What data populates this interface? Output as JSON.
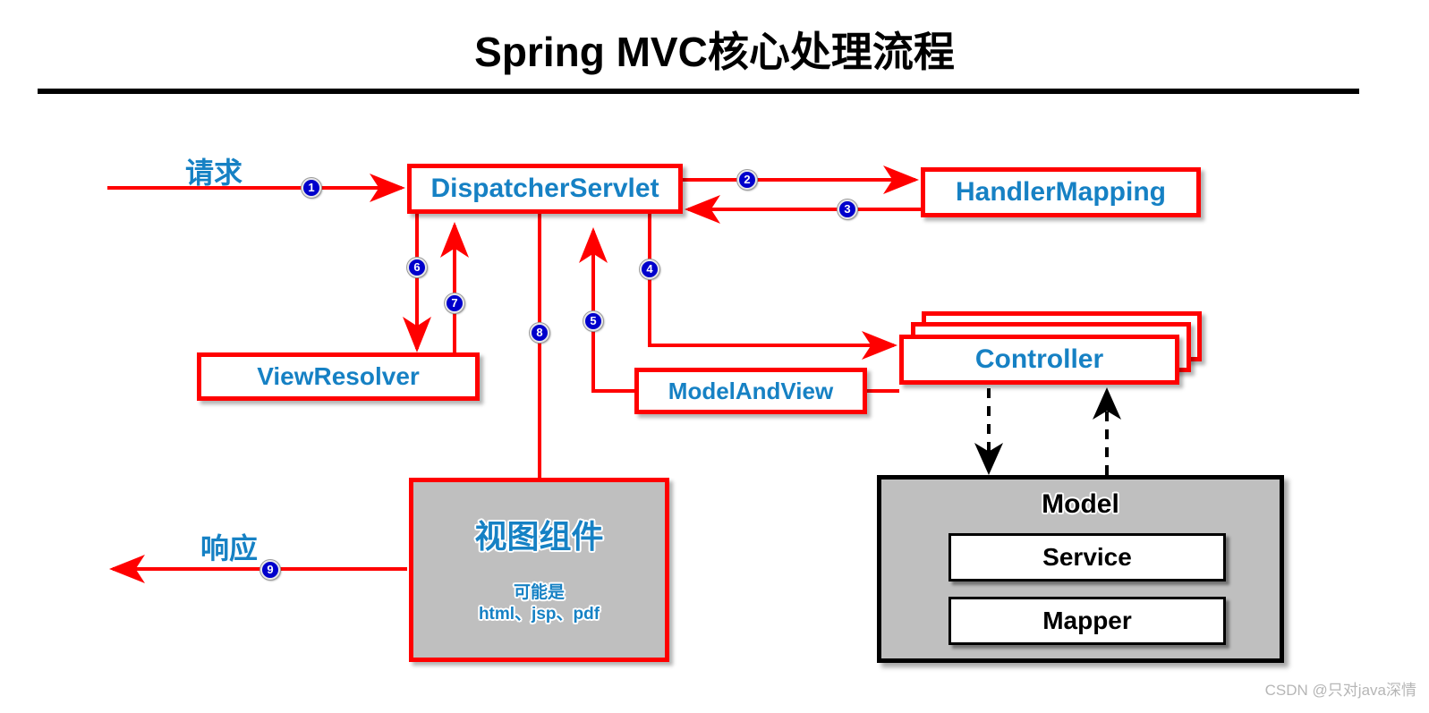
{
  "page": {
    "title": "Spring MVC核心处理流程",
    "watermark": "CSDN @只对java深情",
    "colors": {
      "arrow_red": "#FF0000",
      "node_text_blue": "#1681C4",
      "badge_blue": "#0000CC",
      "panel_gray": "#BFBFBF",
      "rule_black": "#000000"
    }
  },
  "nodes": {
    "dispatcher": "DispatcherServlet",
    "handler_mapping": "HandlerMapping",
    "view_resolver": "ViewResolver",
    "model_and_view": "ModelAndView",
    "controller": "Controller",
    "view_component": {
      "title": "视图组件",
      "subtitle_line1": "可能是",
      "subtitle_line2": "html、jsp、pdf"
    },
    "model": {
      "title": "Model",
      "service": "Service",
      "mapper": "Mapper"
    }
  },
  "flow_labels": {
    "request": "请求",
    "response": "响应"
  },
  "steps": [
    {
      "n": "1",
      "from": "请求",
      "to": "DispatcherServlet"
    },
    {
      "n": "2",
      "from": "DispatcherServlet",
      "to": "HandlerMapping"
    },
    {
      "n": "3",
      "from": "HandlerMapping",
      "to": "DispatcherServlet"
    },
    {
      "n": "4",
      "from": "DispatcherServlet",
      "to": "Controller"
    },
    {
      "n": "5",
      "from": "ModelAndView",
      "to": "DispatcherServlet"
    },
    {
      "n": "6",
      "from": "DispatcherServlet",
      "to": "ViewResolver"
    },
    {
      "n": "7",
      "from": "ViewResolver",
      "to": "DispatcherServlet"
    },
    {
      "n": "8",
      "from": "DispatcherServlet",
      "to": "视图组件"
    },
    {
      "n": "9",
      "from": "视图组件",
      "to": "响应"
    }
  ]
}
